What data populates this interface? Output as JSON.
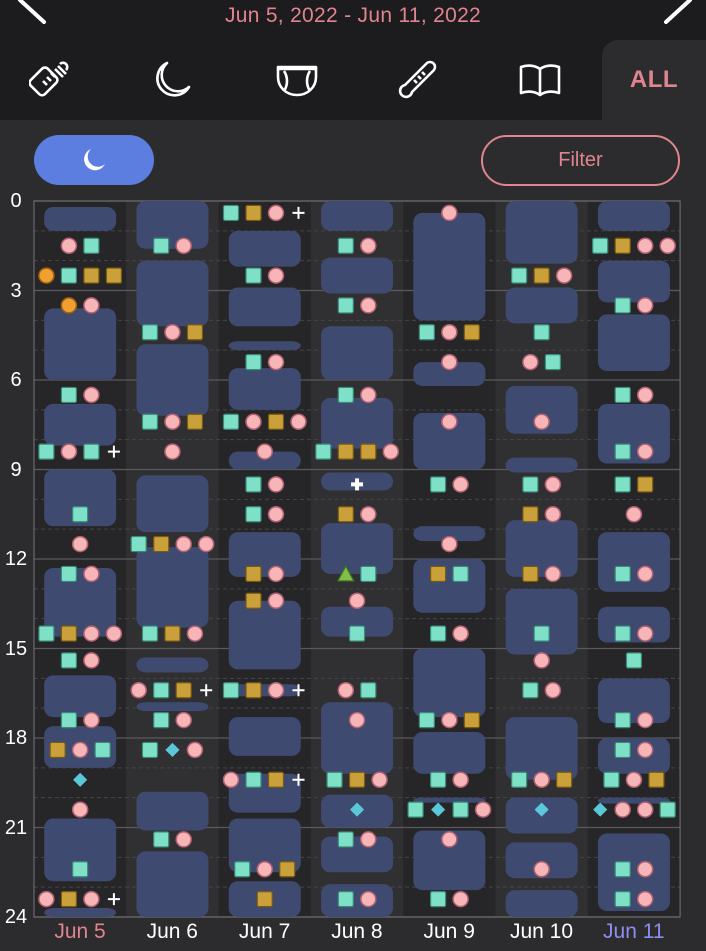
{
  "header": {
    "date_range": "Jun 5, 2022 - Jun 11, 2022",
    "prev_icon": "chevron-left-icon",
    "next_icon": "chevron-right-icon"
  },
  "tabs": [
    {
      "name": "bottle-icon"
    },
    {
      "name": "moon-icon"
    },
    {
      "name": "diaper-icon"
    },
    {
      "name": "thermometer-icon"
    },
    {
      "name": "book-icon"
    },
    {
      "label": "ALL",
      "active": true
    }
  ],
  "controls": {
    "sleep_icon": "moon-icon",
    "filter_label": "Filter"
  },
  "colors": {
    "accent_pink": "#e0848f",
    "sleep_block": "#3f4a70",
    "sleep_button": "#5b7ee0",
    "diaper_teal": "#7fe0c8",
    "diaper_gold": "#c9a03a",
    "feeding_pink": "#f7b5b8",
    "orange": "#f0a030",
    "green_triangle": "#7fbf4a",
    "diamond_blue": "#5ac8d8",
    "today_blue": "#8c8ef0"
  },
  "axis": {
    "hours": [
      "0",
      "3",
      "6",
      "9",
      "12",
      "15",
      "18",
      "21",
      "24"
    ]
  },
  "days": [
    {
      "label": "Jun 5",
      "color": "#e0848f",
      "sleep": [
        [
          0.2,
          1.0
        ],
        [
          3.6,
          6.0
        ],
        [
          6.8,
          8.2
        ],
        [
          9.0,
          10.9
        ],
        [
          12.3,
          14.6
        ],
        [
          15.9,
          17.3
        ],
        [
          17.6,
          19.0
        ],
        [
          20.7,
          22.8
        ],
        [
          23.7,
          24.0
        ]
      ],
      "events": [
        [
          1.5,
          [
            "pink",
            "teal"
          ]
        ],
        [
          2.5,
          [
            "orange",
            "teal",
            "gold",
            "gold"
          ]
        ],
        [
          3.5,
          [
            "orange",
            "pink"
          ]
        ],
        [
          6.5,
          [
            "teal",
            "pink"
          ]
        ],
        [
          8.4,
          [
            "teal",
            "pink",
            "teal",
            "plus"
          ]
        ],
        [
          10.5,
          [
            "teal"
          ]
        ],
        [
          11.5,
          [
            "pink"
          ]
        ],
        [
          12.5,
          [
            "teal",
            "pink"
          ]
        ],
        [
          14.5,
          [
            "teal",
            "gold",
            "pink",
            "pink"
          ]
        ],
        [
          15.4,
          [
            "teal",
            "pink"
          ]
        ],
        [
          17.4,
          [
            "teal",
            "pink"
          ]
        ],
        [
          18.4,
          [
            "gold",
            "pink",
            "teal"
          ]
        ],
        [
          19.4,
          [
            "diamond"
          ]
        ],
        [
          20.4,
          [
            "pink"
          ]
        ],
        [
          22.4,
          [
            "teal"
          ]
        ],
        [
          23.4,
          [
            "pink",
            "gold",
            "pink",
            "plus"
          ]
        ]
      ]
    },
    {
      "label": "Jun 6",
      "color": "#ffffff",
      "sleep": [
        [
          0,
          1.6
        ],
        [
          2.0,
          4.2
        ],
        [
          4.8,
          7.2
        ],
        [
          9.2,
          11.1
        ],
        [
          11.6,
          14.3
        ],
        [
          15.3,
          15.8
        ],
        [
          16.8,
          17.1
        ],
        [
          19.8,
          21.1
        ],
        [
          21.8,
          24.0
        ]
      ],
      "events": [
        [
          1.5,
          [
            "teal",
            "pink"
          ]
        ],
        [
          4.4,
          [
            "teal",
            "pink",
            "gold"
          ]
        ],
        [
          7.4,
          [
            "teal",
            "pink",
            "gold"
          ]
        ],
        [
          8.4,
          [
            "pink"
          ]
        ],
        [
          11.5,
          [
            "teal",
            "gold",
            "pink",
            "pink"
          ]
        ],
        [
          14.5,
          [
            "teal",
            "gold",
            "pink"
          ]
        ],
        [
          16.4,
          [
            "pink",
            "teal",
            "gold",
            "plus"
          ]
        ],
        [
          17.4,
          [
            "teal",
            "pink"
          ]
        ],
        [
          18.4,
          [
            "teal",
            "diamond",
            "pink"
          ]
        ],
        [
          21.4,
          [
            "teal",
            "pink"
          ]
        ]
      ]
    },
    {
      "label": "Jun 7",
      "color": "#ffffff",
      "sleep": [
        [
          1.0,
          2.2
        ],
        [
          2.9,
          4.2
        ],
        [
          4.7,
          5.0
        ],
        [
          5.6,
          7.0
        ],
        [
          8.4,
          9.0
        ],
        [
          11.1,
          12.6
        ],
        [
          13.4,
          15.7
        ],
        [
          16.2,
          16.6
        ],
        [
          17.3,
          18.6
        ],
        [
          19.2,
          20.5
        ],
        [
          20.7,
          22.5
        ],
        [
          22.8,
          24.0
        ]
      ],
      "events": [
        [
          0.4,
          [
            "teal",
            "gold",
            "pink",
            "plus"
          ]
        ],
        [
          2.5,
          [
            "teal",
            "pink"
          ]
        ],
        [
          5.4,
          [
            "teal",
            "pink"
          ]
        ],
        [
          7.4,
          [
            "teal",
            "pink",
            "gold",
            "pink"
          ]
        ],
        [
          8.4,
          [
            "pink"
          ]
        ],
        [
          9.5,
          [
            "teal",
            "pink"
          ]
        ],
        [
          10.5,
          [
            "teal",
            "pink"
          ]
        ],
        [
          12.5,
          [
            "gold",
            "pink"
          ]
        ],
        [
          13.4,
          [
            "gold",
            "pink"
          ]
        ],
        [
          16.4,
          [
            "teal",
            "gold",
            "pink",
            "plus"
          ]
        ],
        [
          19.4,
          [
            "pink",
            "teal",
            "gold",
            "plus"
          ]
        ],
        [
          22.4,
          [
            "teal",
            "pink",
            "gold"
          ]
        ],
        [
          23.4,
          [
            "gold"
          ]
        ]
      ]
    },
    {
      "label": "Jun 8",
      "color": "#ffffff",
      "sleep": [
        [
          0,
          1.0
        ],
        [
          1.9,
          3.1
        ],
        [
          4.2,
          6.0
        ],
        [
          6.6,
          8.3
        ],
        [
          9.1,
          9.7
        ],
        [
          10.8,
          12.5
        ],
        [
          13.6,
          14.6
        ],
        [
          16.8,
          19.2
        ],
        [
          19.9,
          21.0
        ],
        [
          21.3,
          22.5
        ],
        [
          22.9,
          24.0
        ]
      ],
      "events": [
        [
          1.5,
          [
            "teal",
            "pink"
          ]
        ],
        [
          3.5,
          [
            "teal",
            "pink"
          ]
        ],
        [
          6.5,
          [
            "teal",
            "pink"
          ]
        ],
        [
          8.4,
          [
            "teal",
            "gold",
            "gold",
            "pink"
          ]
        ],
        [
          9.5,
          [
            "cross"
          ]
        ],
        [
          10.5,
          [
            "gold",
            "pink"
          ]
        ],
        [
          12.5,
          [
            "tri",
            "teal"
          ]
        ],
        [
          13.4,
          [
            "pink"
          ]
        ],
        [
          14.5,
          [
            "teal"
          ]
        ],
        [
          16.4,
          [
            "pink",
            "teal"
          ]
        ],
        [
          17.4,
          [
            "pink"
          ]
        ],
        [
          19.4,
          [
            "teal",
            "gold",
            "pink"
          ]
        ],
        [
          20.4,
          [
            "diamond"
          ]
        ],
        [
          21.4,
          [
            "teal",
            "pink"
          ]
        ],
        [
          23.4,
          [
            "teal",
            "pink"
          ]
        ]
      ]
    },
    {
      "label": "Jun 9",
      "color": "#ffffff",
      "sleep": [
        [
          0.4,
          4.0
        ],
        [
          5.4,
          6.2
        ],
        [
          7.1,
          9.0
        ],
        [
          10.9,
          11.4
        ],
        [
          12.0,
          13.8
        ],
        [
          15.0,
          17.3
        ],
        [
          17.8,
          19.2
        ],
        [
          20.0,
          20.1
        ],
        [
          21.1,
          23.1
        ]
      ],
      "events": [
        [
          0.4,
          [
            "pink"
          ]
        ],
        [
          4.4,
          [
            "teal",
            "pink",
            "gold"
          ]
        ],
        [
          5.4,
          [
            "pink"
          ]
        ],
        [
          7.4,
          [
            "pink"
          ]
        ],
        [
          9.5,
          [
            "teal",
            "pink"
          ]
        ],
        [
          11.5,
          [
            "pink"
          ]
        ],
        [
          12.5,
          [
            "gold",
            "teal"
          ]
        ],
        [
          14.5,
          [
            "teal",
            "pink"
          ]
        ],
        [
          17.4,
          [
            "teal",
            "pink",
            "gold"
          ]
        ],
        [
          19.4,
          [
            "teal",
            "pink"
          ]
        ],
        [
          20.4,
          [
            "teal",
            "diamond",
            "teal",
            "pink"
          ]
        ],
        [
          21.4,
          [
            "pink"
          ]
        ],
        [
          23.4,
          [
            "teal",
            "pink"
          ]
        ]
      ]
    },
    {
      "label": "Jun 10",
      "color": "#ffffff",
      "sleep": [
        [
          0,
          2.1
        ],
        [
          2.9,
          4.1
        ],
        [
          6.2,
          7.8
        ],
        [
          8.6,
          9.1
        ],
        [
          10.7,
          12.6
        ],
        [
          13.0,
          15.2
        ],
        [
          17.3,
          19.4
        ],
        [
          20.0,
          21.2
        ],
        [
          21.5,
          22.7
        ],
        [
          23.1,
          24.0
        ]
      ],
      "events": [
        [
          2.5,
          [
            "teal",
            "gold",
            "pink"
          ]
        ],
        [
          4.4,
          [
            "teal"
          ]
        ],
        [
          5.4,
          [
            "pink",
            "teal"
          ]
        ],
        [
          7.4,
          [
            "pink"
          ]
        ],
        [
          9.5,
          [
            "teal",
            "pink"
          ]
        ],
        [
          10.5,
          [
            "gold",
            "pink"
          ]
        ],
        [
          12.5,
          [
            "gold",
            "pink"
          ]
        ],
        [
          14.5,
          [
            "teal"
          ]
        ],
        [
          15.4,
          [
            "pink"
          ]
        ],
        [
          16.4,
          [
            "teal",
            "pink"
          ]
        ],
        [
          19.4,
          [
            "teal",
            "pink",
            "gold"
          ]
        ],
        [
          20.4,
          [
            "diamond"
          ]
        ],
        [
          22.4,
          [
            "pink"
          ]
        ]
      ]
    },
    {
      "label": "Jun 11",
      "color": "#8c8ef0",
      "sleep": [
        [
          0,
          1.0
        ],
        [
          2.0,
          3.4
        ],
        [
          3.8,
          5.7
        ],
        [
          6.8,
          8.8
        ],
        [
          11.1,
          13.1
        ],
        [
          13.6,
          14.8
        ],
        [
          16.0,
          17.5
        ],
        [
          18.0,
          19.2
        ],
        [
          20.0,
          20.2
        ],
        [
          21.2,
          23.8
        ]
      ],
      "events": [
        [
          1.5,
          [
            "teal",
            "gold",
            "pink",
            "pink"
          ]
        ],
        [
          3.5,
          [
            "teal",
            "pink"
          ]
        ],
        [
          6.5,
          [
            "teal",
            "pink"
          ]
        ],
        [
          8.4,
          [
            "teal",
            "pink"
          ]
        ],
        [
          9.5,
          [
            "teal",
            "gold"
          ]
        ],
        [
          10.5,
          [
            "pink"
          ]
        ],
        [
          12.5,
          [
            "teal",
            "pink"
          ]
        ],
        [
          14.5,
          [
            "teal",
            "pink"
          ]
        ],
        [
          15.4,
          [
            "teal"
          ]
        ],
        [
          17.4,
          [
            "teal",
            "pink"
          ]
        ],
        [
          18.4,
          [
            "teal",
            "pink"
          ]
        ],
        [
          19.4,
          [
            "teal",
            "pink",
            "gold"
          ]
        ],
        [
          20.4,
          [
            "diamond",
            "pink",
            "pink",
            "teal"
          ]
        ],
        [
          22.4,
          [
            "teal",
            "pink"
          ]
        ],
        [
          23.4,
          [
            "teal",
            "pink"
          ]
        ]
      ]
    }
  ]
}
